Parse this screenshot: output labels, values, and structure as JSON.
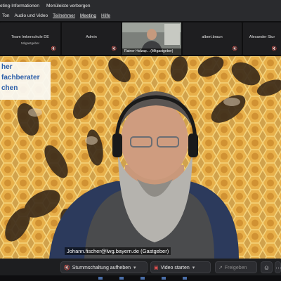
{
  "menubar": {
    "row1": [
      "eting-Informationen",
      "Menüleiste verbergen"
    ],
    "row2": [
      "Ton",
      "Audio und Video",
      "Teilnehmer",
      "Meeting",
      "Hilfe"
    ]
  },
  "participants": [
    {
      "name": "Team Imkerschule DE",
      "sub": "Mitgastgeber",
      "muted": true
    },
    {
      "name": "Admin",
      "sub": "",
      "muted": true
    },
    {
      "name": "Rainer Holzap... (Mitgastgeber)",
      "video": true
    },
    {
      "name": "albert.braun",
      "sub": "",
      "muted": true
    },
    {
      "name": "Alexander Stur",
      "sub": "",
      "muted": true
    }
  ],
  "main": {
    "overlay_lines": [
      "her",
      "fachberater",
      "chen"
    ],
    "speaker_label": "Johann.fischer@lwg.bayern.de (Gastgeber)"
  },
  "toolbar": {
    "unmute_label": "Stummschaltung aufheben",
    "video_label": "Video starten",
    "share_label": "Freigeben"
  },
  "colors": {
    "accent": "#e05050",
    "overlay_text": "#2b5ea8"
  }
}
